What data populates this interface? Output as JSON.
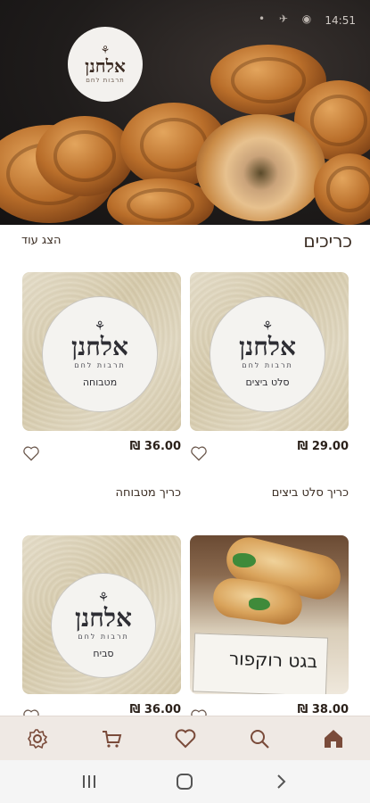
{
  "status_bar": {
    "time": "14:51"
  },
  "brand": {
    "name": "אלחנן",
    "tagline": "תרבות לחם"
  },
  "section": {
    "title": "כריכים",
    "show_more": "הצג עוד"
  },
  "products": [
    {
      "name": "כריך סלט ביצים",
      "price": "29.00 ₪",
      "sticker_text": "סלט ביצים"
    },
    {
      "name": "כריך מטבוחה",
      "price": "36.00 ₪",
      "sticker_text": "מטבוחה"
    },
    {
      "price": "38.00 ₪",
      "sign_text": "בגט רוקפור"
    },
    {
      "price": "36.00 ₪",
      "sticker_text": "סביח"
    }
  ],
  "bottom_nav": [
    {
      "icon": "home-icon"
    },
    {
      "icon": "search-icon"
    },
    {
      "icon": "heart-icon"
    },
    {
      "icon": "cart-icon"
    },
    {
      "icon": "settings-icon"
    }
  ],
  "colors": {
    "accent": "#7a4b3a",
    "nav_bg": "#efe9e4"
  }
}
